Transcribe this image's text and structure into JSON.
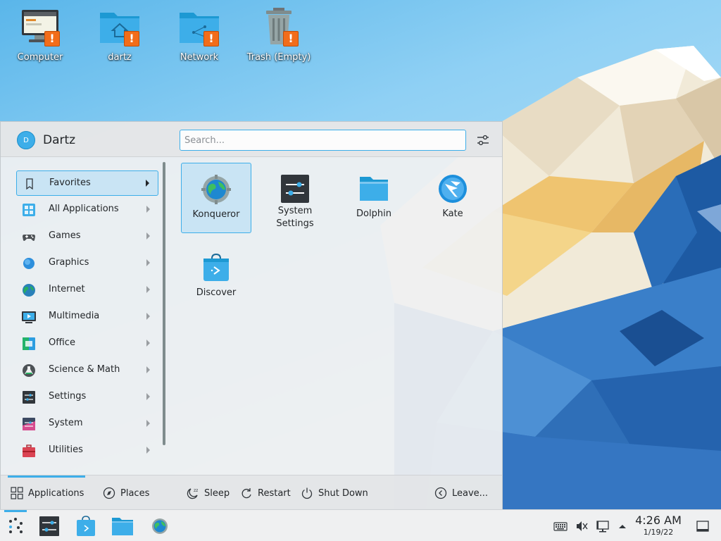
{
  "desktop": {
    "icons": [
      {
        "label": "Computer"
      },
      {
        "label": "dartz"
      },
      {
        "label": "Network"
      },
      {
        "label": "Trash (Empty)"
      }
    ],
    "warning_glyph": "!"
  },
  "launcher": {
    "user": {
      "initial": "D",
      "name": "Dartz"
    },
    "search": {
      "placeholder": "Search...",
      "value": ""
    },
    "categories": [
      {
        "label": "Favorites",
        "icon": "bookmark-icon",
        "active": true
      },
      {
        "label": "All Applications",
        "icon": "grid-icon"
      },
      {
        "label": "Games",
        "icon": "gamepad-icon"
      },
      {
        "label": "Graphics",
        "icon": "graphics-icon"
      },
      {
        "label": "Internet",
        "icon": "globe-icon"
      },
      {
        "label": "Multimedia",
        "icon": "multimedia-icon"
      },
      {
        "label": "Office",
        "icon": "office-icon"
      },
      {
        "label": "Science & Math",
        "icon": "flask-icon"
      },
      {
        "label": "Settings",
        "icon": "settings-icon"
      },
      {
        "label": "System",
        "icon": "system-icon"
      },
      {
        "label": "Utilities",
        "icon": "toolbox-icon"
      }
    ],
    "apps": [
      {
        "label": "Konqueror",
        "icon": "konqueror-icon",
        "active": true
      },
      {
        "label": "System\nSettings",
        "icon": "system-settings-icon"
      },
      {
        "label": "Dolphin",
        "icon": "dolphin-icon"
      },
      {
        "label": "Kate",
        "icon": "kate-icon"
      },
      {
        "label": "Discover",
        "icon": "discover-icon"
      }
    ],
    "footer": {
      "applications": "Applications",
      "places": "Places",
      "sleep": "Sleep",
      "restart": "Restart",
      "shutdown": "Shut Down",
      "leave": "Leave..."
    }
  },
  "taskbar": {
    "clock": {
      "time": "4:26 AM",
      "date": "1/19/22"
    }
  },
  "colors": {
    "accent": "#3daee9",
    "selection": "#c9e4f4",
    "warning": "#f26d1a"
  }
}
